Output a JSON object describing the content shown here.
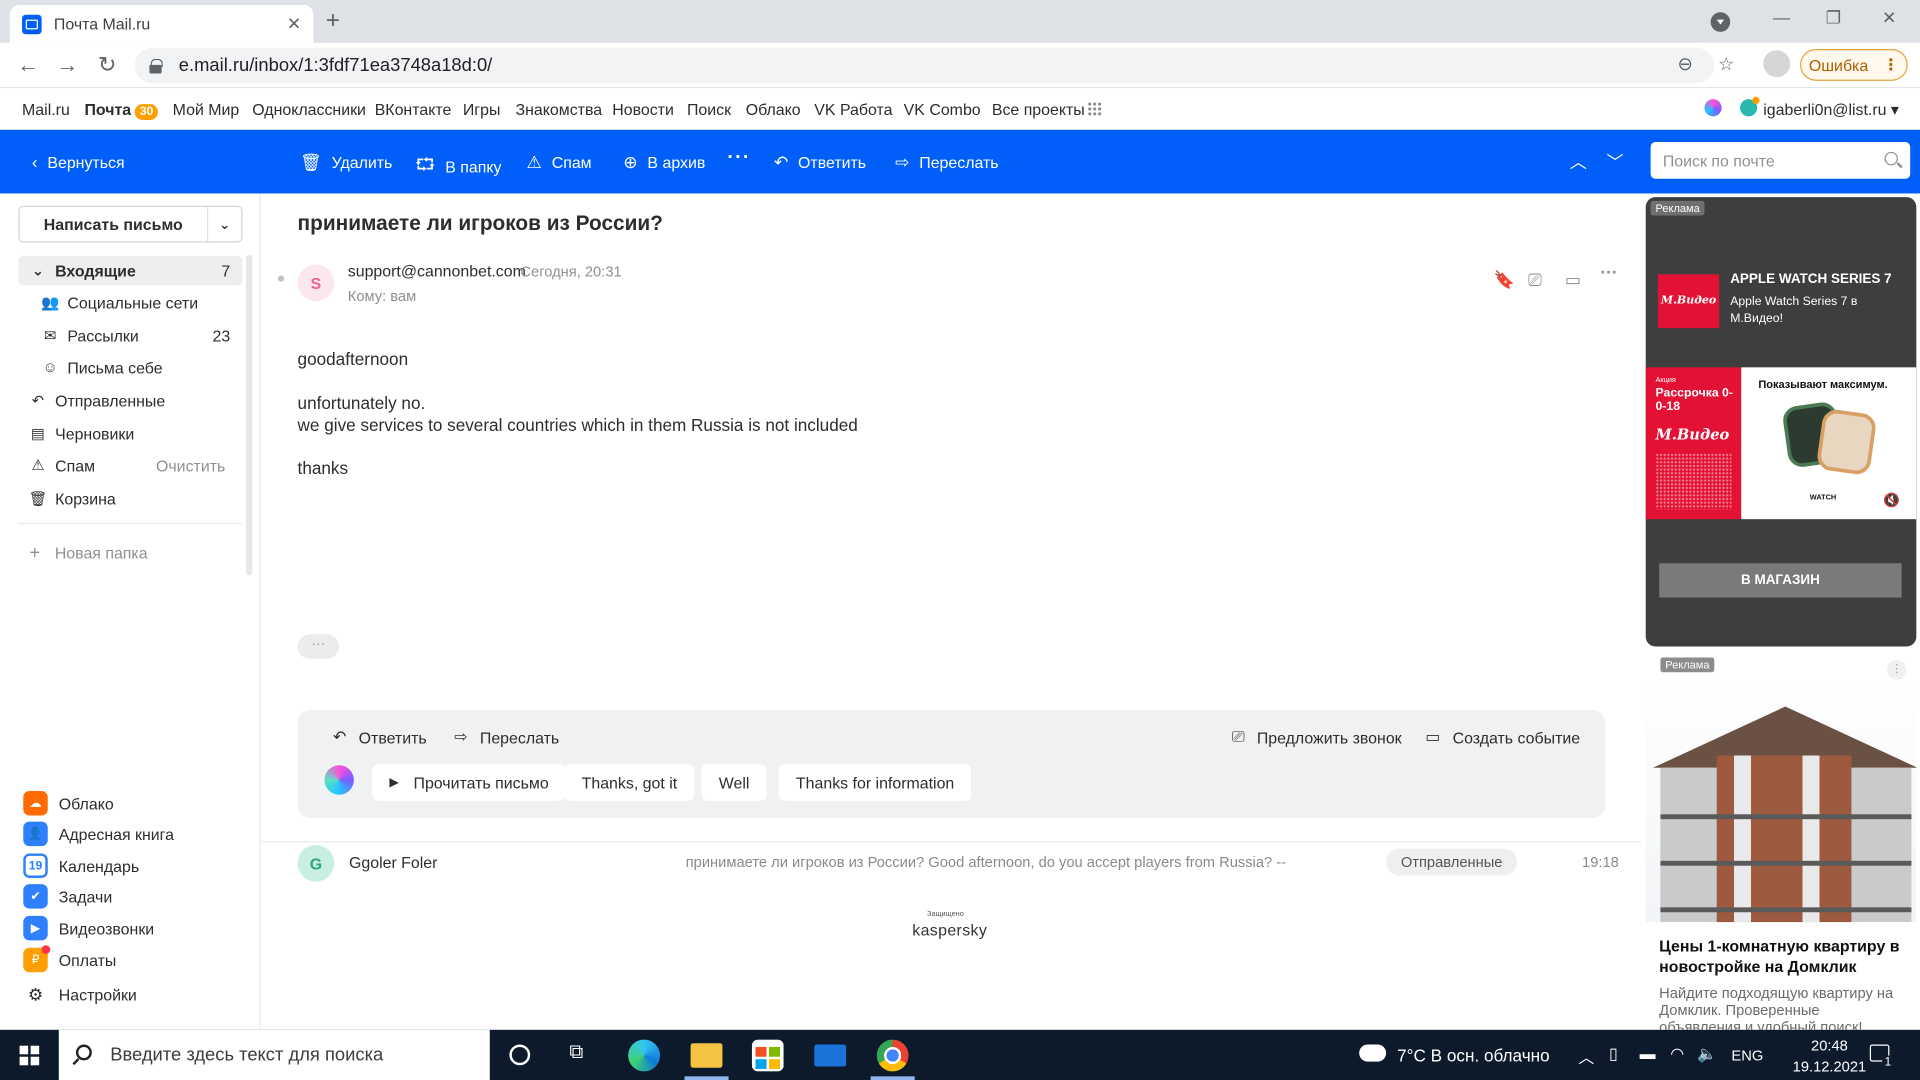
{
  "browser": {
    "tab_title": "Почта Mail.ru",
    "tab_close": "✕",
    "new_tab": "+",
    "url": "e.mail.ru/inbox/1:3fdf71ea3748a18d:0/",
    "error_button": "Ошибка",
    "window_controls": {
      "minimize": "—",
      "maximize": "❐",
      "close": "✕"
    },
    "nav": {
      "back": "←",
      "forward": "→",
      "reload": "↻"
    }
  },
  "portal_menu": {
    "items": [
      "Mail.ru",
      "Почта",
      "Мой Мир",
      "Одноклассники",
      "ВКонтакте",
      "Игры",
      "Знакомства",
      "Новости",
      "Поиск",
      "Облако",
      "VK Работа",
      "VK Combo",
      "Все проекты"
    ],
    "mail_badge": "30",
    "user_email": "igaberli0n@list.ru ▾"
  },
  "mail_toolbar": {
    "back": "Вернуться",
    "delete": "Удалить",
    "to_folder": "В папку",
    "spam": "Спам",
    "archive": "В архив",
    "more": "···",
    "reply": "Ответить",
    "forward": "Переслать",
    "search_placeholder": "Поиск по почте"
  },
  "sidebar": {
    "compose": "Написать письмо",
    "folders": [
      {
        "label": "Входящие",
        "count": "7"
      },
      {
        "label": "Социальные сети",
        "count": ""
      },
      {
        "label": "Рассылки",
        "count": "23"
      },
      {
        "label": "Письма себе",
        "count": ""
      },
      {
        "label": "Отправленные",
        "count": ""
      },
      {
        "label": "Черновики",
        "count": ""
      },
      {
        "label": "Спам",
        "action": "Очистить"
      },
      {
        "label": "Корзина",
        "count": ""
      }
    ],
    "new_folder": "Новая папка",
    "apps": [
      "Облако",
      "Адресная книга",
      "Календарь",
      "Задачи",
      "Видеозвонки",
      "Оплаты",
      "Настройки"
    ],
    "calendar_day": "19"
  },
  "message": {
    "subject": "принимаете ли игроков из России?",
    "sender_initial": "S",
    "sender": "support@cannonbet.com",
    "time": "Сегодня, 20:31",
    "to": "Кому:  вам",
    "body": [
      "goodafternoon",
      "unfortunately no.",
      "we give services to several countries which in them Russia is not included",
      "thanks"
    ],
    "quote_toggle": "···"
  },
  "reply_panel": {
    "reply": "Ответить",
    "forward": "Переслать",
    "propose_call": "Предложить звонок",
    "create_event": "Создать событие",
    "quick_replies": [
      "Прочитать письмо",
      "Thanks, got it",
      "Well",
      "Thanks for information"
    ]
  },
  "thread": {
    "initial": "G",
    "name": "Ggoler Foler",
    "snippet": "принимаете ли игроков из России? Good afternoon, do you accept players from Russia? --",
    "folder": "Отправленные",
    "time": "19:18"
  },
  "protection": {
    "small": "Защищено",
    "brand": "kaspersky"
  },
  "ads": {
    "label": "Реклама",
    "ad1": {
      "logo": "М.Видео",
      "title": "APPLE WATCH SERIES 7",
      "subtitle": "Apple Watch Series 7 в М.Видео!",
      "red_small": "Акция",
      "red_title": "Рассрочка 0-0-18",
      "red_logo": "М.Видео",
      "white_title": "Показывают максимум.",
      "watch_brand": "WATCH",
      "button": "В МАГАЗИН"
    },
    "ad2": {
      "title": "Цены 1-комнатную квартиру в новостройке на Домклик",
      "desc": "Найдите подходящую квартиру на Домклик. Проверенные объявления и удобный поиск!"
    }
  },
  "taskbar": {
    "search_placeholder": "Введите здесь текст для поиска",
    "weather": "7°C  В осн. облачно",
    "lang": "ENG",
    "time": "20:48",
    "date": "19.12.2021",
    "notifications": "1"
  }
}
